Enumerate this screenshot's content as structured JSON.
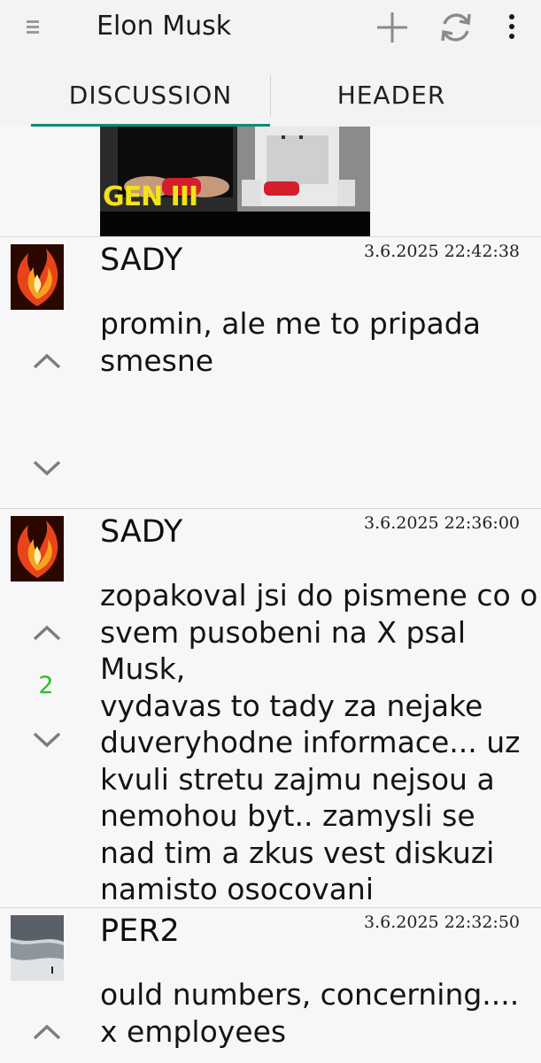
{
  "toolbar": {
    "title": "Elon Musk",
    "icons": [
      "menu-icon",
      "add-icon",
      "refresh-icon",
      "more-vert-icon"
    ]
  },
  "tabs": [
    {
      "label": "DISCUSSION",
      "selected": true
    },
    {
      "label": "HEADER",
      "selected": false
    }
  ],
  "image_banner": {
    "overlay_text": "GEN III"
  },
  "comments": [
    {
      "author": "SADY",
      "timestamp": "3.6.2025 22:42:38",
      "text": "promin, ale me to pripada smesne",
      "score": ""
    },
    {
      "author": "SADY",
      "timestamp": "3.6.2025 22:36:00",
      "text": "zopakoval jsi do pismene co o svem pusobeni na X psal Musk,\nvydavas to tady za nejake duveryhodne informace... uz kvuli stretu zajmu nejsou a nemohou byt.. zamysli se nad tim a zkus vest diskuzi namisto osocovani",
      "score": "2"
    },
    {
      "author": "PER2",
      "timestamp": "3.6.2025 22:32:50",
      "text": "ould numbers, concerning.... x employees",
      "score": ""
    }
  ],
  "colors": {
    "accent": "#0e8a73",
    "score_positive": "#2bbf2b",
    "icon": "#8a8a8a"
  }
}
